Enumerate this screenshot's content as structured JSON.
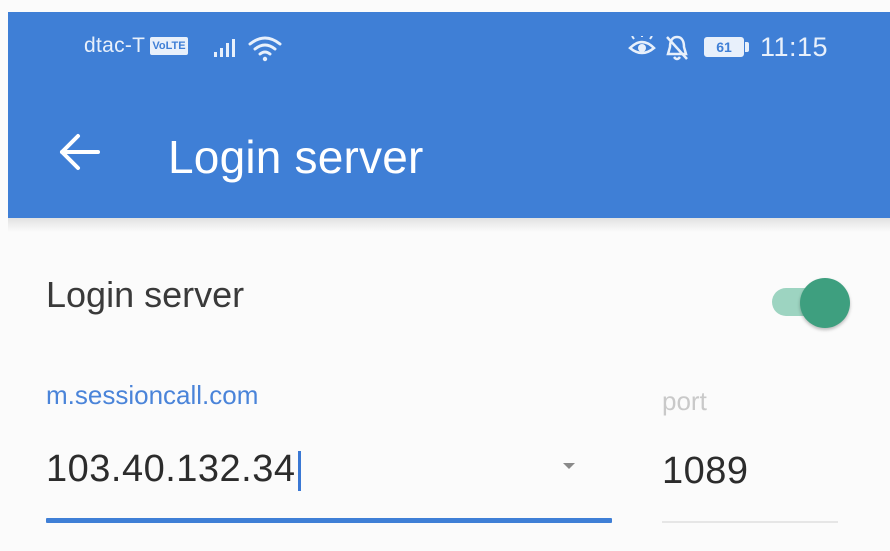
{
  "status_bar": {
    "carrier": "dtac-T",
    "volte_badge": "VoLTE",
    "battery_level": "61",
    "time": "11:15"
  },
  "app_bar": {
    "title": "Login server",
    "background_color": "#3f7fd6",
    "back_icon": "arrow-left-icon"
  },
  "settings": {
    "login_server": {
      "label": "Login server",
      "enabled": true,
      "toggle_color": "#3e9f7f"
    },
    "host": {
      "label": "m.sessioncall.com",
      "value": "103.40.132.34",
      "dropdown_icon": "caret-down-icon"
    },
    "port": {
      "label": "port",
      "value": "1089"
    }
  }
}
